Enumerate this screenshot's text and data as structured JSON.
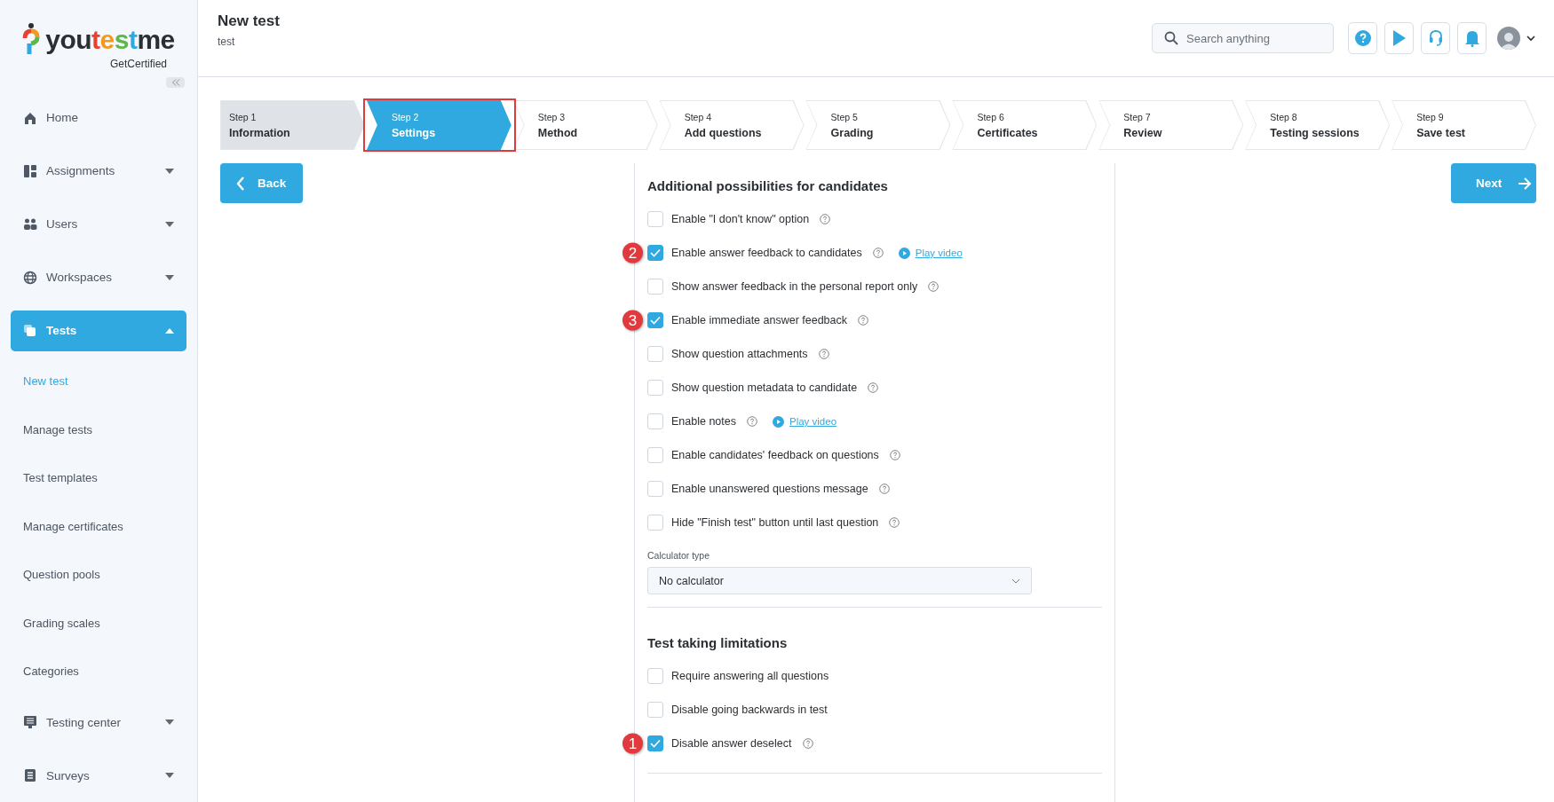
{
  "logo": {
    "parts": [
      {
        "text": "you",
        "color": "#2b2f33"
      },
      {
        "text": "t",
        "color": "#e5432f"
      },
      {
        "text": "e",
        "color": "#f39a1e"
      },
      {
        "text": "s",
        "color": "#5cb848"
      },
      {
        "text": "t",
        "color": "#2fa9df"
      },
      {
        "text": "me",
        "color": "#2b2f33"
      }
    ],
    "tagline": "GetCertified"
  },
  "sidebar": {
    "items": [
      {
        "label": "Home",
        "expandable": false,
        "expanded": false,
        "selected": false
      },
      {
        "label": "Assignments",
        "expandable": true,
        "expanded": false,
        "selected": false
      },
      {
        "label": "Users",
        "expandable": true,
        "expanded": false,
        "selected": false
      },
      {
        "label": "Workspaces",
        "expandable": true,
        "expanded": false,
        "selected": false
      },
      {
        "label": "Tests",
        "expandable": true,
        "expanded": true,
        "selected": true,
        "children": [
          {
            "label": "New test",
            "selected": true
          },
          {
            "label": "Manage tests",
            "selected": false
          },
          {
            "label": "Test templates",
            "selected": false
          },
          {
            "label": "Manage certificates",
            "selected": false
          },
          {
            "label": "Question pools",
            "selected": false
          },
          {
            "label": "Grading scales",
            "selected": false
          },
          {
            "label": "Categories",
            "selected": false
          }
        ]
      },
      {
        "label": "Testing center",
        "expandable": true,
        "expanded": false,
        "selected": false
      },
      {
        "label": "Surveys",
        "expandable": true,
        "expanded": false,
        "selected": false
      }
    ]
  },
  "header": {
    "title": "New test",
    "subtitle": "test",
    "search": {
      "placeholder": "Search anything"
    }
  },
  "steps": [
    {
      "number": "Step 1",
      "label": "Information",
      "selected": false,
      "completed": true,
      "highlighted": false
    },
    {
      "number": "Step 2",
      "label": "Settings",
      "selected": true,
      "completed": false,
      "highlighted": true
    },
    {
      "number": "Step 3",
      "label": "Method",
      "selected": false,
      "completed": false,
      "highlighted": false
    },
    {
      "number": "Step 4",
      "label": "Add questions",
      "selected": false,
      "completed": false,
      "highlighted": false
    },
    {
      "number": "Step 5",
      "label": "Grading",
      "selected": false,
      "completed": false,
      "highlighted": false
    },
    {
      "number": "Step 6",
      "label": "Certificates",
      "selected": false,
      "completed": false,
      "highlighted": false
    },
    {
      "number": "Step 7",
      "label": "Review",
      "selected": false,
      "completed": false,
      "highlighted": false
    },
    {
      "number": "Step 8",
      "label": "Testing sessions",
      "selected": false,
      "completed": false,
      "highlighted": false
    },
    {
      "number": "Step 9",
      "label": "Save test",
      "selected": false,
      "completed": false,
      "highlighted": false
    }
  ],
  "back_button": "Back",
  "next_button": "Next",
  "sections": [
    {
      "title": "Additional possibilities for candidates",
      "options": [
        {
          "label": "Enable \"I don't know\" option",
          "checked": false,
          "help": true
        },
        {
          "label": "Enable answer feedback to candidates",
          "checked": true,
          "help": true,
          "video_link": "Play video",
          "marker": "2"
        },
        {
          "label": "Show answer feedback in the personal report only",
          "checked": false,
          "help": true
        },
        {
          "label": "Enable immediate answer feedback",
          "checked": true,
          "help": true,
          "marker": "3"
        },
        {
          "label": "Show question attachments",
          "checked": false,
          "help": true
        },
        {
          "label": "Show question metadata to candidate",
          "checked": false,
          "help": true
        },
        {
          "label": "Enable notes",
          "checked": false,
          "help": true,
          "video_link": "Play video"
        },
        {
          "label": "Enable candidates' feedback on questions",
          "checked": false,
          "help": true
        },
        {
          "label": "Enable unanswered questions message",
          "checked": false,
          "help": true
        },
        {
          "label": "Hide \"Finish test\" button until last question",
          "checked": false,
          "help": true
        }
      ],
      "select": {
        "label": "Calculator type",
        "value": "No calculator"
      }
    },
    {
      "title": "Test taking limitations",
      "options": [
        {
          "label": "Require answering all questions",
          "checked": false,
          "help": false
        },
        {
          "label": "Disable going backwards in test",
          "checked": false,
          "help": false
        },
        {
          "label": "Disable answer deselect",
          "checked": true,
          "help": true,
          "marker": "1"
        }
      ]
    }
  ]
}
